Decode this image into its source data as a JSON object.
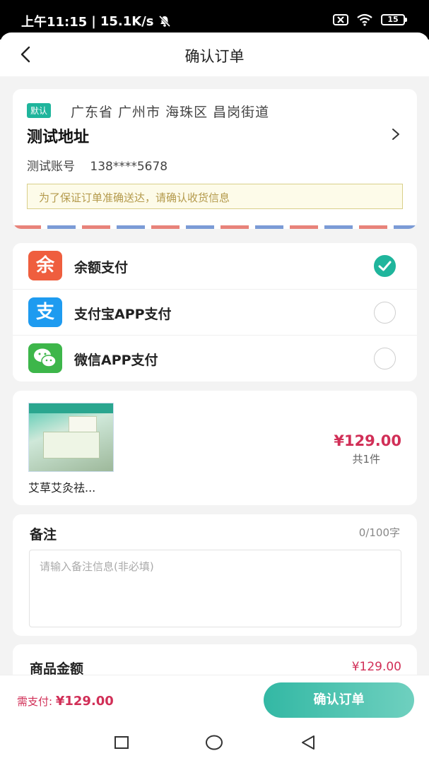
{
  "status_bar": {
    "time": "上午11:15",
    "speed": "15.1K/s",
    "battery": "15"
  },
  "nav": {
    "title": "确认订单"
  },
  "address": {
    "default_tag": "默认",
    "region": "广东省 广州市 海珠区 昌岗街道",
    "name": "测试地址",
    "contact_name": "测试账号",
    "phone": "138****5678",
    "notice": "为了保证订单准确送达，请确认收货信息"
  },
  "payment": {
    "methods": [
      {
        "icon": "balance-icon",
        "glyph": "余",
        "label": "余额支付",
        "color": "#ef5e3e",
        "selected": true
      },
      {
        "icon": "alipay-icon",
        "glyph": "支",
        "label": "支付宝APP支付",
        "color": "#1e9bf0",
        "selected": false
      },
      {
        "icon": "wechat-icon",
        "glyph": "",
        "label": "微信APP支付",
        "color": "#3db64a",
        "selected": false
      }
    ]
  },
  "goods": {
    "name": "艾草艾灸祛...",
    "price": "¥129.00",
    "quantity": "共1件"
  },
  "remark": {
    "title": "备注",
    "count": "0/100字",
    "placeholder": "请输入备注信息(非必填)"
  },
  "amount": {
    "label": "商品金额",
    "value": "¥129.00"
  },
  "bottom": {
    "need_pay_label": "需支付:",
    "need_pay_value": "¥129.00",
    "confirm_label": "确认订单"
  },
  "colors": {
    "accent": "#1fb59c",
    "price": "#d12f57"
  }
}
